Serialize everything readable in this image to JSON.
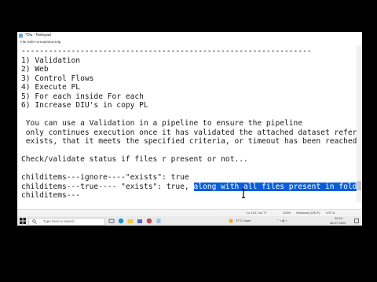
{
  "window": {
    "title": "*Diu - Notepad"
  },
  "menu": [
    "File",
    "Edit",
    "Format",
    "View",
    "Help"
  ],
  "editor": {
    "lines": [
      "----------------------------------------------------------------",
      "1) Validation",
      "2) Web",
      "3) Control Flows",
      "4) Execute PL",
      "5) For each inside For each",
      "6) Increase DIU's in copy PL",
      "",
      " You can use a Validation in a pipeline to ensure the pipeline",
      " only continues execution once it has validated the attached dataset reference",
      " exists, that it meets the specified criteria, or timeout has been reached.",
      "",
      "Check/validate status if files r present or not...",
      "",
      "childitems---ignore----\"exists\": true"
    ],
    "line_true_prefix": "childitems---true---- \"exists\": true, ",
    "line_true_selected": "along with all files present in folder",
    "last_line": "childitems---"
  },
  "status": {
    "position": "Ln 119, Col 77",
    "zoom": "100%",
    "line_ending": "Windows (CRLF)",
    "encoding": "UTF-8"
  },
  "taskbar": {
    "search_placeholder": "Type here to search",
    "weather": "27°C Haze",
    "time": "09:24",
    "date": "08-07-2022"
  }
}
